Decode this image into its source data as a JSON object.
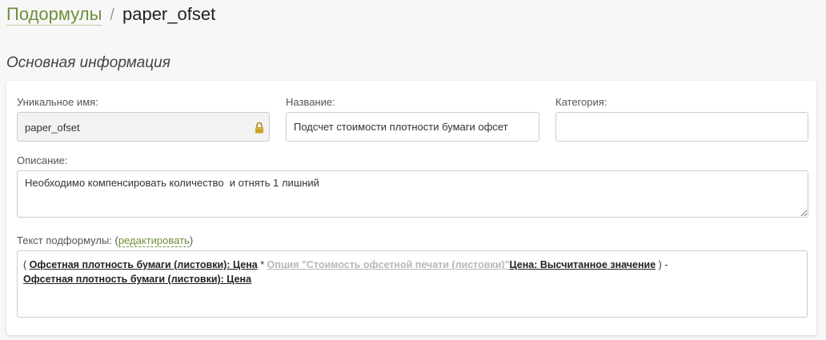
{
  "breadcrumb": {
    "parent": "Подормулы",
    "separator": "/",
    "current": "paper_ofset"
  },
  "section_title": "Основная информация",
  "fields": {
    "unique_name": {
      "label": "Уникальное имя:",
      "value": "paper_ofset",
      "icon": "lock-icon"
    },
    "title": {
      "label": "Название:",
      "value": "Подсчет стоимости плотности бумаги офсет"
    },
    "category": {
      "label": "Категория:",
      "value": ""
    },
    "description": {
      "label": "Описание:",
      "value": "Необходимо компенсировать количество  и отнять 1 лишний"
    }
  },
  "formula": {
    "label": "Текст подформулы:",
    "edit_open": "(",
    "edit_link": "редактировать",
    "edit_close": ")",
    "paren_open": "(",
    "token1": "Офсетная плотность бумаги (листовки): Цена",
    "multiply": "*",
    "token2": "Опция \"Стоимость офсетной печати (листовки)\"",
    "token3": "Цена: Высчитанное значение",
    "paren_close": ")",
    "minus": "-",
    "token4": "Офсетная плотность бумаги (листовки): Цена"
  },
  "colors": {
    "accent": "#6d8f3c",
    "option_token": "#b8b8b8",
    "lock": "#c9a227"
  }
}
